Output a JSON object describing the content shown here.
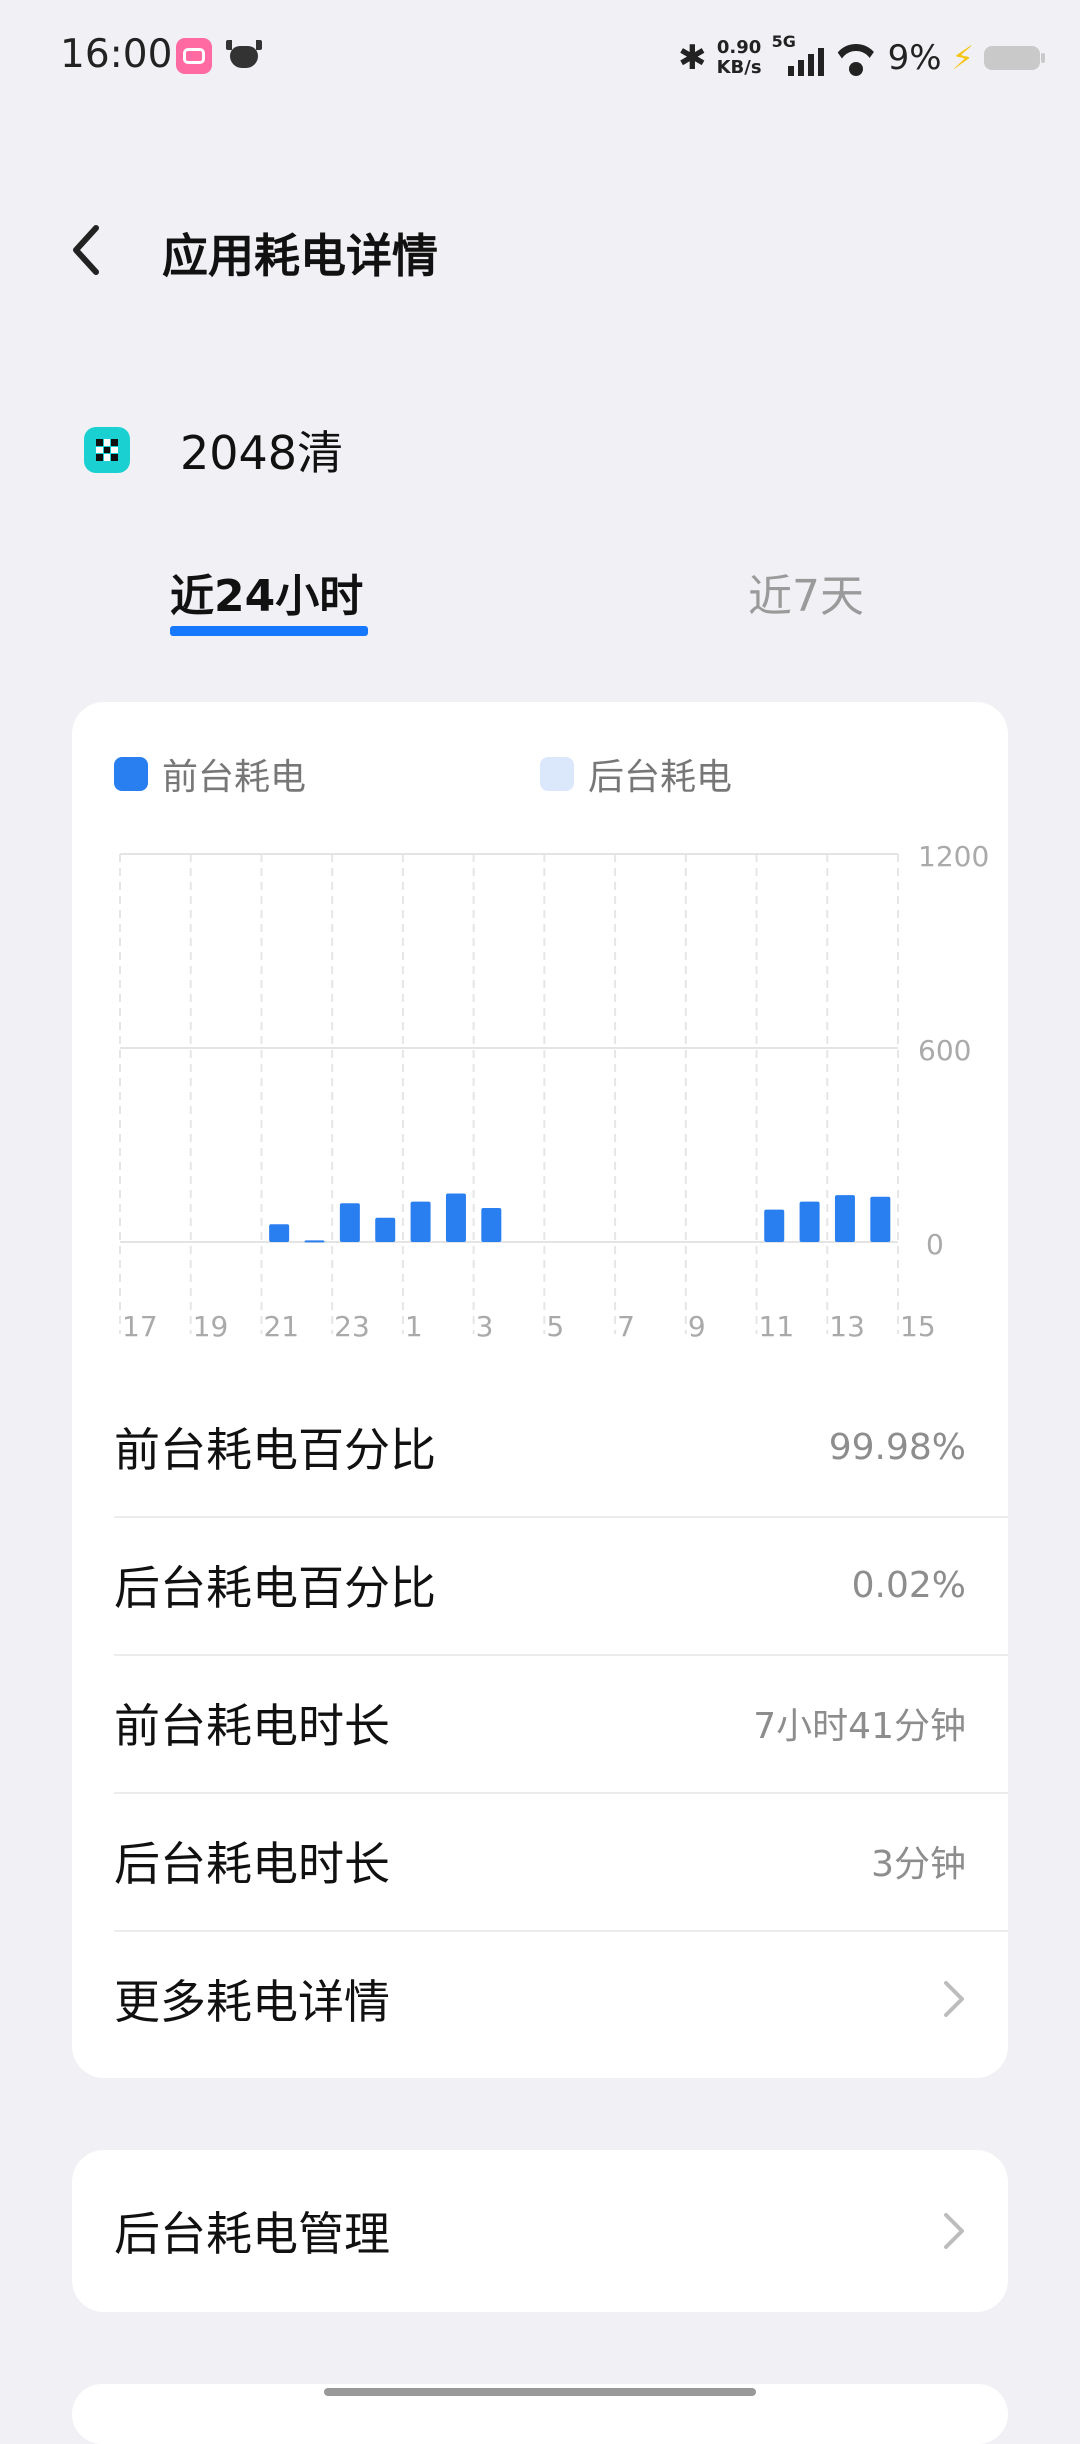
{
  "status_bar": {
    "time": "16:00",
    "net_speed_value": "0.90",
    "net_speed_unit": "KB/s",
    "network_type": "5G",
    "battery_percent": "9%",
    "icons": [
      "bilibili-icon",
      "cow-app-icon",
      "bluetooth-icon",
      "signal-icon",
      "wifi-icon",
      "charging-bolt-icon",
      "battery-icon"
    ]
  },
  "header": {
    "title": "应用耗电详情"
  },
  "app": {
    "name": "2048清"
  },
  "tabs": [
    {
      "label": "近24小时",
      "active": true
    },
    {
      "label": "近7天",
      "active": false
    }
  ],
  "legend": {
    "foreground": "前台耗电",
    "background": "后台耗电"
  },
  "colors": {
    "foreground": "#2a7ff0",
    "background": "#dbe8fb",
    "accent": "#1677ff"
  },
  "chart_data": {
    "type": "bar",
    "title": "",
    "xlabel": "",
    "ylabel": "",
    "ylim": [
      0,
      1200
    ],
    "y_ticks": [
      "1200",
      "600",
      "0"
    ],
    "x_tick_labels": [
      "17",
      "19",
      "21",
      "23",
      "1",
      "3",
      "5",
      "7",
      "9",
      "11",
      "13",
      "15"
    ],
    "categories": [
      "17",
      "18",
      "19",
      "20",
      "21",
      "22",
      "23",
      "0",
      "1",
      "2",
      "3",
      "4",
      "5",
      "6",
      "7",
      "8",
      "9",
      "10",
      "11",
      "12",
      "13",
      "14",
      "15"
    ],
    "series": [
      {
        "name": "前台耗电",
        "values": [
          0,
          0,
          0,
          0,
          55,
          5,
          120,
          75,
          125,
          150,
          105,
          0,
          0,
          0,
          0,
          0,
          0,
          0,
          100,
          125,
          145,
          140,
          0
        ]
      },
      {
        "name": "后台耗电",
        "values": [
          0,
          0,
          0,
          0,
          0,
          0,
          0,
          0,
          0,
          0,
          0,
          0,
          0,
          0,
          0,
          0,
          0,
          0,
          0,
          0,
          0,
          0,
          0
        ]
      }
    ],
    "grid": true
  },
  "stats": [
    {
      "label": "前台耗电百分比",
      "value": "99.98%"
    },
    {
      "label": "后台耗电百分比",
      "value": "0.02%"
    },
    {
      "label": "前台耗电时长",
      "value": "7小时41分钟"
    },
    {
      "label": "后台耗电时长",
      "value": "3分钟"
    },
    {
      "label": "更多耗电详情",
      "value": ""
    }
  ],
  "bg_manage": {
    "label": "后台耗电管理"
  }
}
